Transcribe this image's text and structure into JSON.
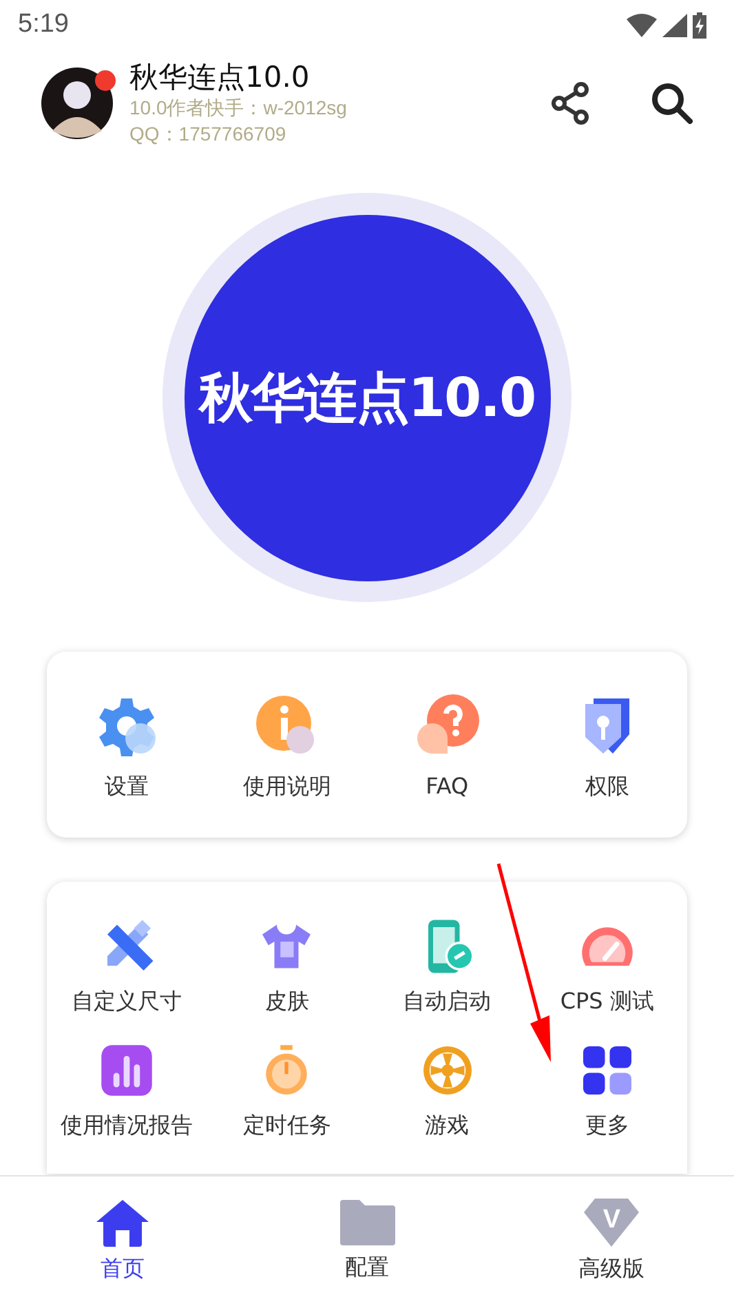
{
  "status_bar": {
    "time": "5:19"
  },
  "header": {
    "title": "秋华连点10.0",
    "lines": [
      "10.0作者快手：w-2012sg",
      "QQ：1757766709"
    ],
    "avatar_badge": true
  },
  "main_button": {
    "label": "秋华连点10.0"
  },
  "cards": [
    {
      "items": [
        {
          "kind": "gear",
          "label": "设置"
        },
        {
          "kind": "info",
          "label": "使用说明"
        },
        {
          "kind": "question",
          "label": "FAQ"
        },
        {
          "kind": "shield",
          "label": "权限"
        }
      ]
    },
    {
      "items": [
        {
          "kind": "ruler",
          "label": "自定义尺寸"
        },
        {
          "kind": "shirt",
          "label": "皮肤"
        },
        {
          "kind": "phone",
          "label": "自动启动"
        },
        {
          "kind": "gauge",
          "label": "CPS 测试"
        },
        {
          "kind": "chart",
          "label": "使用情况报告"
        },
        {
          "kind": "timer",
          "label": "定时任务"
        },
        {
          "kind": "wheel",
          "label": "游戏"
        },
        {
          "kind": "grid",
          "label": "更多"
        }
      ]
    }
  ],
  "bottom_nav": [
    {
      "kind": "home",
      "label": "首页",
      "selected": true
    },
    {
      "kind": "folder",
      "label": "配置",
      "selected": false
    },
    {
      "kind": "vip",
      "label": "高级版",
      "selected": false,
      "icon_letter": "V"
    }
  ],
  "annotation": {
    "kind": "arrow"
  }
}
